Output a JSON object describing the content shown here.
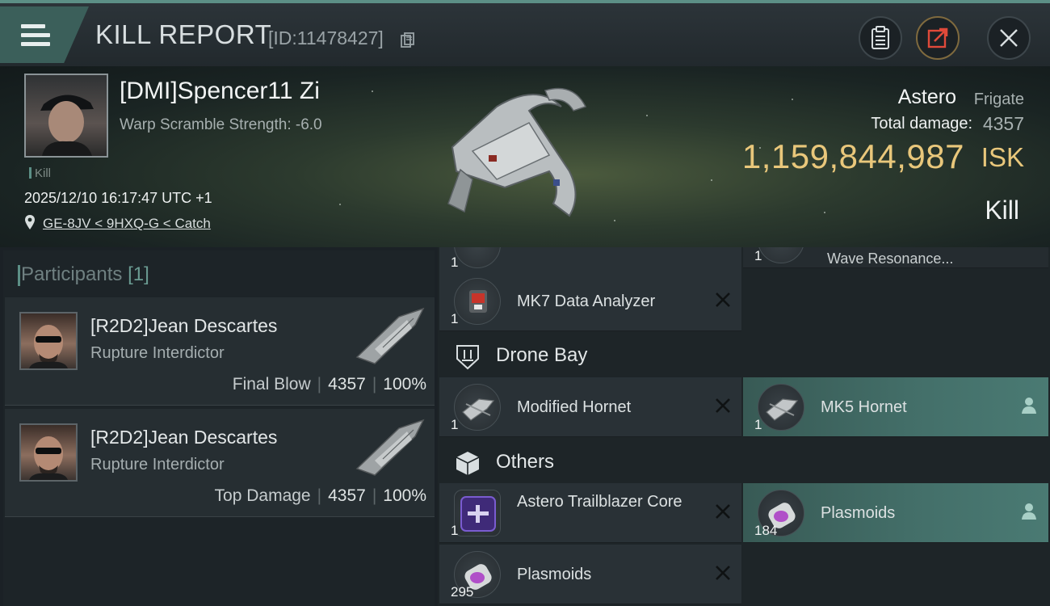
{
  "header": {
    "title": "KILL REPORT",
    "report_id": "[ID:11478427]",
    "icons": {
      "menu": "menu-icon",
      "copy": "copy-icon",
      "clipboard": "clipboard-icon",
      "share": "share-icon",
      "close": "close-icon"
    }
  },
  "victim": {
    "name": "[DMI]Spencer11 Zi",
    "warp_scramble": "Warp Scramble Strength: -6.0",
    "tag": "Kill",
    "timestamp": "2025/12/10 16:17:47 UTC +1",
    "location": "GE-8JV < 9HXQ-G < Catch",
    "ship_name": "Astero",
    "ship_class": "Frigate",
    "total_damage_label": "Total damage:",
    "total_damage": "4357",
    "isk_value": "1,159,844,987",
    "isk_unit": "ISK",
    "outcome": "Kill"
  },
  "participants": {
    "label": "Participants",
    "count": "[1]",
    "rows": [
      {
        "name": "[R2D2]Jean Descartes",
        "ship": "Rupture Interdictor",
        "role": "Final Blow",
        "damage": "4357",
        "percent": "100%"
      },
      {
        "name": "[R2D2]Jean Descartes",
        "ship": "Rupture Interdictor",
        "role": "Top Damage",
        "damage": "4357",
        "percent": "100%"
      }
    ]
  },
  "items": {
    "top_partial": [
      {
        "qty": "1",
        "name": ""
      },
      {
        "qty": "1",
        "name": "Wave Resonance..."
      }
    ],
    "loose": [
      {
        "qty": "1",
        "name": "MK7 Data Analyzer",
        "status": "destroyed"
      }
    ],
    "drone_bay": {
      "title": "Drone Bay",
      "items": [
        {
          "qty": "1",
          "name": "Modified Hornet",
          "status": "destroyed"
        },
        {
          "qty": "1",
          "name": "MK5 Hornet",
          "status": "dropped"
        }
      ]
    },
    "others": {
      "title": "Others",
      "items": [
        {
          "qty": "1",
          "name": "Astero Trailblazer Core",
          "status": "destroyed"
        },
        {
          "qty": "184",
          "name": "Plasmoids",
          "status": "dropped"
        },
        {
          "qty": "295",
          "name": "Plasmoids",
          "status": "destroyed"
        }
      ]
    }
  },
  "colors": {
    "accent": "#5c8f86",
    "isk_gold": "#e9c77b",
    "dropped_bg": "#44706a"
  }
}
